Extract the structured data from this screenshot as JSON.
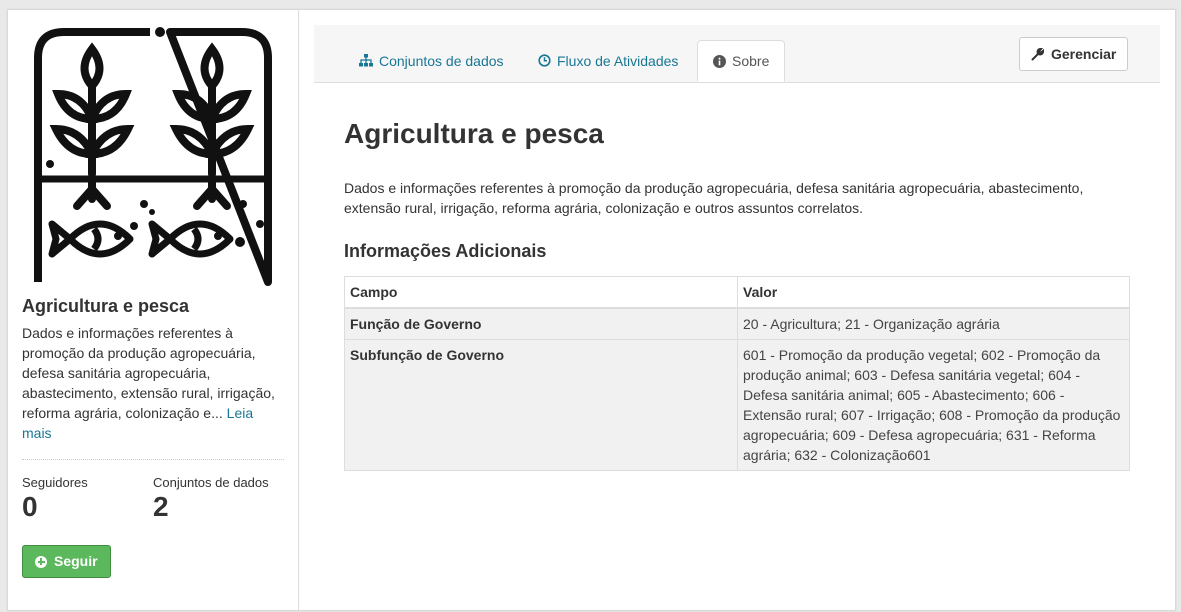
{
  "sidebar": {
    "logo_alt": "Agricultura e pesca",
    "title": "Agricultura e pesca",
    "description": "Dados e informações referentes à promoção da produção agropecuária, defesa sanitária agropecuária, abastecimento, extensão rural, irrigação, reforma agrária, colonização e...",
    "read_more": "Leia mais",
    "stats": [
      {
        "label": "Seguidores",
        "value": "0"
      },
      {
        "label": "Conjuntos de dados",
        "value": "2"
      }
    ],
    "follow_label": "Seguir"
  },
  "tabs": [
    {
      "label": "Conjuntos de dados",
      "icon": "sitemap-icon"
    },
    {
      "label": "Fluxo de Atividades",
      "icon": "clock-icon"
    },
    {
      "label": "Sobre",
      "icon": "info-icon",
      "active": true
    }
  ],
  "manage_label": "Gerenciar",
  "main": {
    "title": "Agricultura e pesca",
    "description": "Dados e informações referentes à promoção da produção agropecuária, defesa sanitária agropecuária, abastecimento, extensão rural, irrigação, reforma agrária, colonização e outros assuntos correlatos.",
    "additional_title": "Informações Adicionais",
    "table": {
      "headers": [
        "Campo",
        "Valor"
      ],
      "rows": [
        {
          "field": "Função de Governo",
          "value": "20 - Agricultura; 21 - Organização agrária"
        },
        {
          "field": "Subfunção de Governo",
          "value": "601 - Promoção da produção vegetal; 602 - Promoção da produção animal; 603 - Defesa sanitária vegetal; 604 - Defesa sanitária animal; 605 - Abastecimento; 606 - Extensão rural; 607 - Irrigação; 608 - Promoção da produção agropecuária; 609 - Defesa agropecuária; 631 - Reforma agrária; 632 - Colonização601"
        }
      ]
    }
  },
  "colors": {
    "link": "#187794",
    "follow_button": "#5cb85c",
    "table_row_bg": "#f1f1f1"
  }
}
